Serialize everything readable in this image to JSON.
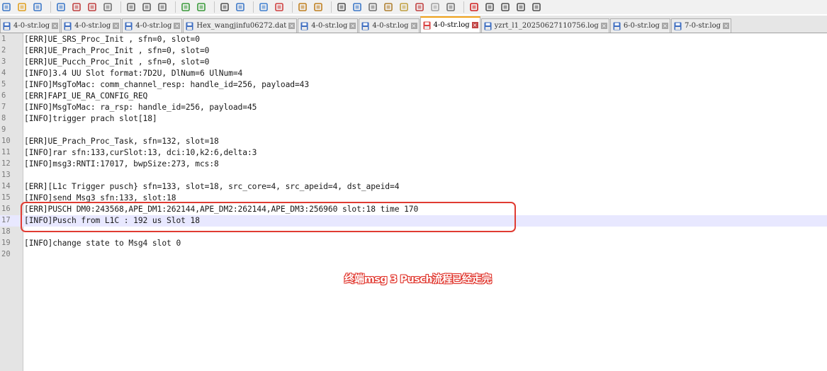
{
  "toolbar": {
    "icons": [
      "new-file-icon",
      "open-folder-icon",
      "save-icon",
      "save-all-icon",
      "close-icon",
      "close-all-icon",
      "print-icon",
      "cut-icon",
      "copy-icon",
      "paste-icon",
      "undo-icon",
      "redo-icon",
      "find-icon",
      "replace-icon",
      "zoom-in-icon",
      "zoom-out-icon",
      "sync-vertical-icon",
      "sync-horizontal-icon",
      "word-wrap-icon",
      "show-all-chars-icon",
      "indent-guide-icon",
      "user-language-icon",
      "doc-map-icon",
      "function-list-icon",
      "folder-workspace-icon",
      "monitor-icon",
      "record-macro-icon",
      "stop-macro-icon",
      "play-macro-icon",
      "run-macro-multiple-icon",
      "save-macro-icon"
    ]
  },
  "tabs": [
    {
      "label": "4-0-str.log",
      "state": "saved"
    },
    {
      "label": "4-0-str.log",
      "state": "saved"
    },
    {
      "label": "4-0-str.log",
      "state": "saved"
    },
    {
      "label": "Hex_wangjinfu06272.dat",
      "state": "saved"
    },
    {
      "label": "4-0-str.log",
      "state": "saved"
    },
    {
      "label": "4-0-str.log",
      "state": "saved"
    },
    {
      "label": "4-0-str.log",
      "state": "active"
    },
    {
      "label": "yzrt_l1_20250627110756.log",
      "state": "saved"
    },
    {
      "label": "6-0-str.log",
      "state": "saved"
    },
    {
      "label": "7-0-str.log",
      "state": "saved"
    }
  ],
  "editor": {
    "current_line": 17,
    "lines": [
      {
        "n": "1",
        "text": "[ERR]UE_SRS_Proc_Init , sfn=0, slot=0"
      },
      {
        "n": "2",
        "text": "[ERR]UE_Prach_Proc_Init , sfn=0, slot=0"
      },
      {
        "n": "3",
        "text": "[ERR]UE_Pucch_Proc_Init , sfn=0, slot=0"
      },
      {
        "n": "4",
        "text": "[INFO]3.4 UU Slot format:7D2U, DlNum=6 UlNum=4"
      },
      {
        "n": "5",
        "text": "[INFO]MsgToMac: comm_channel_resp: handle_id=256, payload=43"
      },
      {
        "n": "6",
        "text": "[ERR]FAPI_UE_RA_CONFIG_REQ"
      },
      {
        "n": "7",
        "text": "[INFO]MsgToMac: ra_rsp: handle_id=256, payload=45"
      },
      {
        "n": "8",
        "text": "[INFO]trigger prach slot[18]"
      },
      {
        "n": "9",
        "text": ""
      },
      {
        "n": "10",
        "text": "[ERR]UE_Prach_Proc_Task, sfn=132, slot=18"
      },
      {
        "n": "11",
        "text": "[INFO]rar sfn:133,curSlot:13, dci:10,k2:6,delta:3"
      },
      {
        "n": "12",
        "text": "[INFO]msg3:RNTI:17017, bwpSize:273, mcs:8"
      },
      {
        "n": "13",
        "text": ""
      },
      {
        "n": "14",
        "text": "[ERR][L1c Trigger pusch} sfn=133, slot=18, src_core=4, src_apeid=4, dst_apeid=4"
      },
      {
        "n": "15",
        "text": "[INFO]send Msg3 sfn:133, slot:18"
      },
      {
        "n": "16",
        "text": "[ERR]PUSCH DM0:243568,APE_DM1:262144,APE_DM2:262144,APE_DM3:256960 slot:18 time 170"
      },
      {
        "n": "17",
        "text": "[INFO]Pusch from L1C : 192 us Slot 18"
      },
      {
        "n": "18",
        "text": ""
      },
      {
        "n": "19",
        "text": "[INFO]change state to Msg4 slot 0"
      },
      {
        "n": "20",
        "text": ""
      }
    ]
  },
  "annotation": {
    "text": "终端msg 3 Pusch流程已经走完",
    "color": "#e0332a"
  }
}
